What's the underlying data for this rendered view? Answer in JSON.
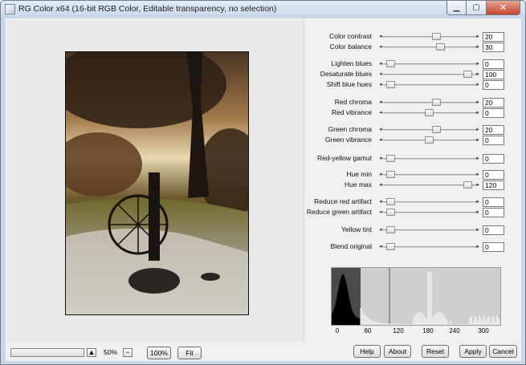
{
  "window": {
    "title": "RG Color x64 (16-bit RGB Color, Editable transparency, no selection)",
    "caption_min": "▁",
    "caption_max": "▢",
    "caption_close": "✕"
  },
  "sliders": [
    {
      "label": "Color contrast",
      "value": "20",
      "level": 0.59
    },
    {
      "label": "Color balance",
      "value": "30",
      "level": 0.63
    },
    {
      "label": "Lighten blues",
      "value": "0",
      "level": 0.04
    },
    {
      "label": "Desaturate blues",
      "value": "100",
      "level": 0.96
    },
    {
      "label": "Shift blue hues",
      "value": "0",
      "level": 0.04
    },
    {
      "label": "Red chroma",
      "value": "20",
      "level": 0.59
    },
    {
      "label": "Red vibrance",
      "value": "0",
      "level": 0.5
    },
    {
      "label": "Green chroma",
      "value": "20",
      "level": 0.59
    },
    {
      "label": "Green vibrance",
      "value": "0",
      "level": 0.5
    },
    {
      "label": "Red-yellow gamut",
      "value": "0",
      "level": 0.04
    },
    {
      "label": "Hue min",
      "value": "0",
      "level": 0.04
    },
    {
      "label": "Hue max",
      "value": "120",
      "level": 0.96
    },
    {
      "label": "Reduce red artifact",
      "value": "0",
      "level": 0.04
    },
    {
      "label": "Reduce green artifact",
      "value": "0",
      "level": 0.04
    },
    {
      "label": "Yellow tint",
      "value": "0",
      "level": 0.04
    },
    {
      "label": "Blend original",
      "value": "0",
      "level": 0.04
    }
  ],
  "histogram": {
    "ticks": [
      "0",
      "60",
      "120",
      "180",
      "240",
      "300"
    ],
    "colors": {
      "background": "#cfcfcf",
      "left_fill": "#4a4a4a",
      "dark": "#000000",
      "light": "#ffffff"
    }
  },
  "zoom": {
    "up": "▲",
    "value": "50%",
    "down": "−",
    "btn_100": "100%",
    "btn_fit": "Fit"
  },
  "buttons": {
    "help": "Help",
    "about": "About",
    "reset": "Reset",
    "apply": "Apply",
    "cancel": "Cancel"
  }
}
